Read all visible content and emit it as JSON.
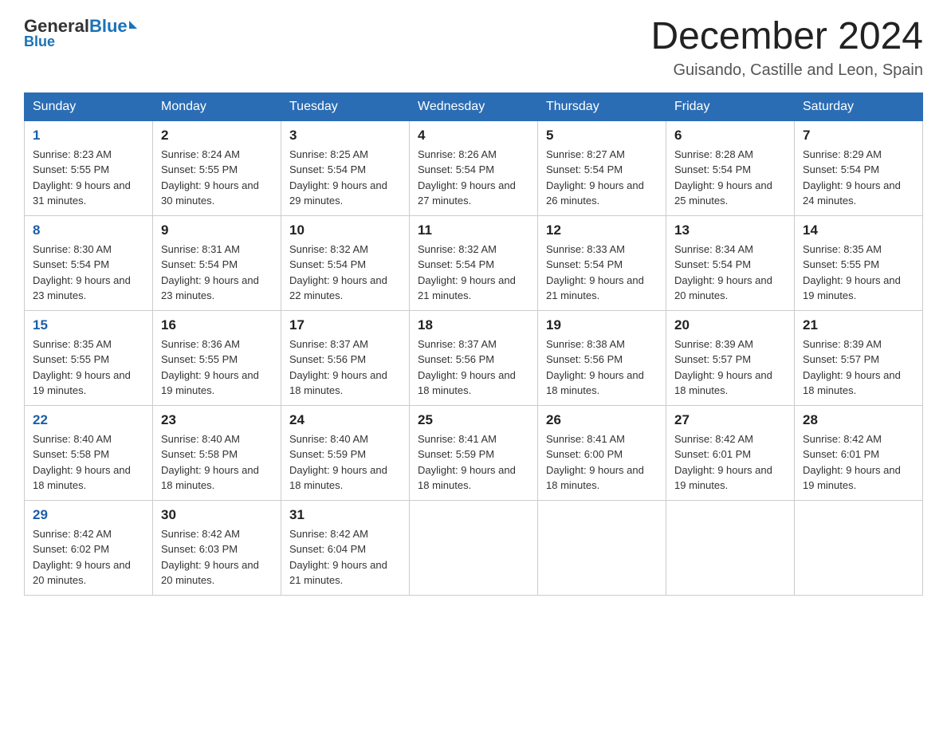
{
  "header": {
    "logo_general": "General",
    "logo_blue": "Blue",
    "main_title": "December 2024",
    "subtitle": "Guisando, Castille and Leon, Spain"
  },
  "calendar": {
    "weekdays": [
      "Sunday",
      "Monday",
      "Tuesday",
      "Wednesday",
      "Thursday",
      "Friday",
      "Saturday"
    ],
    "weeks": [
      [
        {
          "day": "1",
          "sunrise": "8:23 AM",
          "sunset": "5:55 PM",
          "daylight": "9 hours and 31 minutes."
        },
        {
          "day": "2",
          "sunrise": "8:24 AM",
          "sunset": "5:55 PM",
          "daylight": "9 hours and 30 minutes."
        },
        {
          "day": "3",
          "sunrise": "8:25 AM",
          "sunset": "5:54 PM",
          "daylight": "9 hours and 29 minutes."
        },
        {
          "day": "4",
          "sunrise": "8:26 AM",
          "sunset": "5:54 PM",
          "daylight": "9 hours and 27 minutes."
        },
        {
          "day": "5",
          "sunrise": "8:27 AM",
          "sunset": "5:54 PM",
          "daylight": "9 hours and 26 minutes."
        },
        {
          "day": "6",
          "sunrise": "8:28 AM",
          "sunset": "5:54 PM",
          "daylight": "9 hours and 25 minutes."
        },
        {
          "day": "7",
          "sunrise": "8:29 AM",
          "sunset": "5:54 PM",
          "daylight": "9 hours and 24 minutes."
        }
      ],
      [
        {
          "day": "8",
          "sunrise": "8:30 AM",
          "sunset": "5:54 PM",
          "daylight": "9 hours and 23 minutes."
        },
        {
          "day": "9",
          "sunrise": "8:31 AM",
          "sunset": "5:54 PM",
          "daylight": "9 hours and 23 minutes."
        },
        {
          "day": "10",
          "sunrise": "8:32 AM",
          "sunset": "5:54 PM",
          "daylight": "9 hours and 22 minutes."
        },
        {
          "day": "11",
          "sunrise": "8:32 AM",
          "sunset": "5:54 PM",
          "daylight": "9 hours and 21 minutes."
        },
        {
          "day": "12",
          "sunrise": "8:33 AM",
          "sunset": "5:54 PM",
          "daylight": "9 hours and 21 minutes."
        },
        {
          "day": "13",
          "sunrise": "8:34 AM",
          "sunset": "5:54 PM",
          "daylight": "9 hours and 20 minutes."
        },
        {
          "day": "14",
          "sunrise": "8:35 AM",
          "sunset": "5:55 PM",
          "daylight": "9 hours and 19 minutes."
        }
      ],
      [
        {
          "day": "15",
          "sunrise": "8:35 AM",
          "sunset": "5:55 PM",
          "daylight": "9 hours and 19 minutes."
        },
        {
          "day": "16",
          "sunrise": "8:36 AM",
          "sunset": "5:55 PM",
          "daylight": "9 hours and 19 minutes."
        },
        {
          "day": "17",
          "sunrise": "8:37 AM",
          "sunset": "5:56 PM",
          "daylight": "9 hours and 18 minutes."
        },
        {
          "day": "18",
          "sunrise": "8:37 AM",
          "sunset": "5:56 PM",
          "daylight": "9 hours and 18 minutes."
        },
        {
          "day": "19",
          "sunrise": "8:38 AM",
          "sunset": "5:56 PM",
          "daylight": "9 hours and 18 minutes."
        },
        {
          "day": "20",
          "sunrise": "8:39 AM",
          "sunset": "5:57 PM",
          "daylight": "9 hours and 18 minutes."
        },
        {
          "day": "21",
          "sunrise": "8:39 AM",
          "sunset": "5:57 PM",
          "daylight": "9 hours and 18 minutes."
        }
      ],
      [
        {
          "day": "22",
          "sunrise": "8:40 AM",
          "sunset": "5:58 PM",
          "daylight": "9 hours and 18 minutes."
        },
        {
          "day": "23",
          "sunrise": "8:40 AM",
          "sunset": "5:58 PM",
          "daylight": "9 hours and 18 minutes."
        },
        {
          "day": "24",
          "sunrise": "8:40 AM",
          "sunset": "5:59 PM",
          "daylight": "9 hours and 18 minutes."
        },
        {
          "day": "25",
          "sunrise": "8:41 AM",
          "sunset": "5:59 PM",
          "daylight": "9 hours and 18 minutes."
        },
        {
          "day": "26",
          "sunrise": "8:41 AM",
          "sunset": "6:00 PM",
          "daylight": "9 hours and 18 minutes."
        },
        {
          "day": "27",
          "sunrise": "8:42 AM",
          "sunset": "6:01 PM",
          "daylight": "9 hours and 19 minutes."
        },
        {
          "day": "28",
          "sunrise": "8:42 AM",
          "sunset": "6:01 PM",
          "daylight": "9 hours and 19 minutes."
        }
      ],
      [
        {
          "day": "29",
          "sunrise": "8:42 AM",
          "sunset": "6:02 PM",
          "daylight": "9 hours and 20 minutes."
        },
        {
          "day": "30",
          "sunrise": "8:42 AM",
          "sunset": "6:03 PM",
          "daylight": "9 hours and 20 minutes."
        },
        {
          "day": "31",
          "sunrise": "8:42 AM",
          "sunset": "6:04 PM",
          "daylight": "9 hours and 21 minutes."
        },
        null,
        null,
        null,
        null
      ]
    ]
  }
}
